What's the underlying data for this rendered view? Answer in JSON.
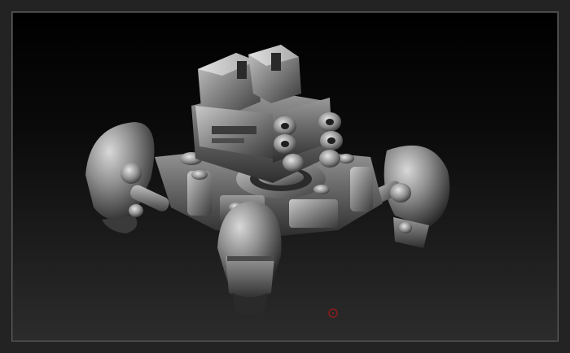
{
  "viewport": {
    "subject": "mech-walker-sculpt",
    "background_top_color": "#000000",
    "background_bottom_color": "#2c2c2c",
    "frame_color": "#5a5a5a",
    "material_color": "#8c8c8c"
  },
  "cursor": {
    "icon": "draw-brush-cursor-icon",
    "color": "#8a1c1c"
  }
}
